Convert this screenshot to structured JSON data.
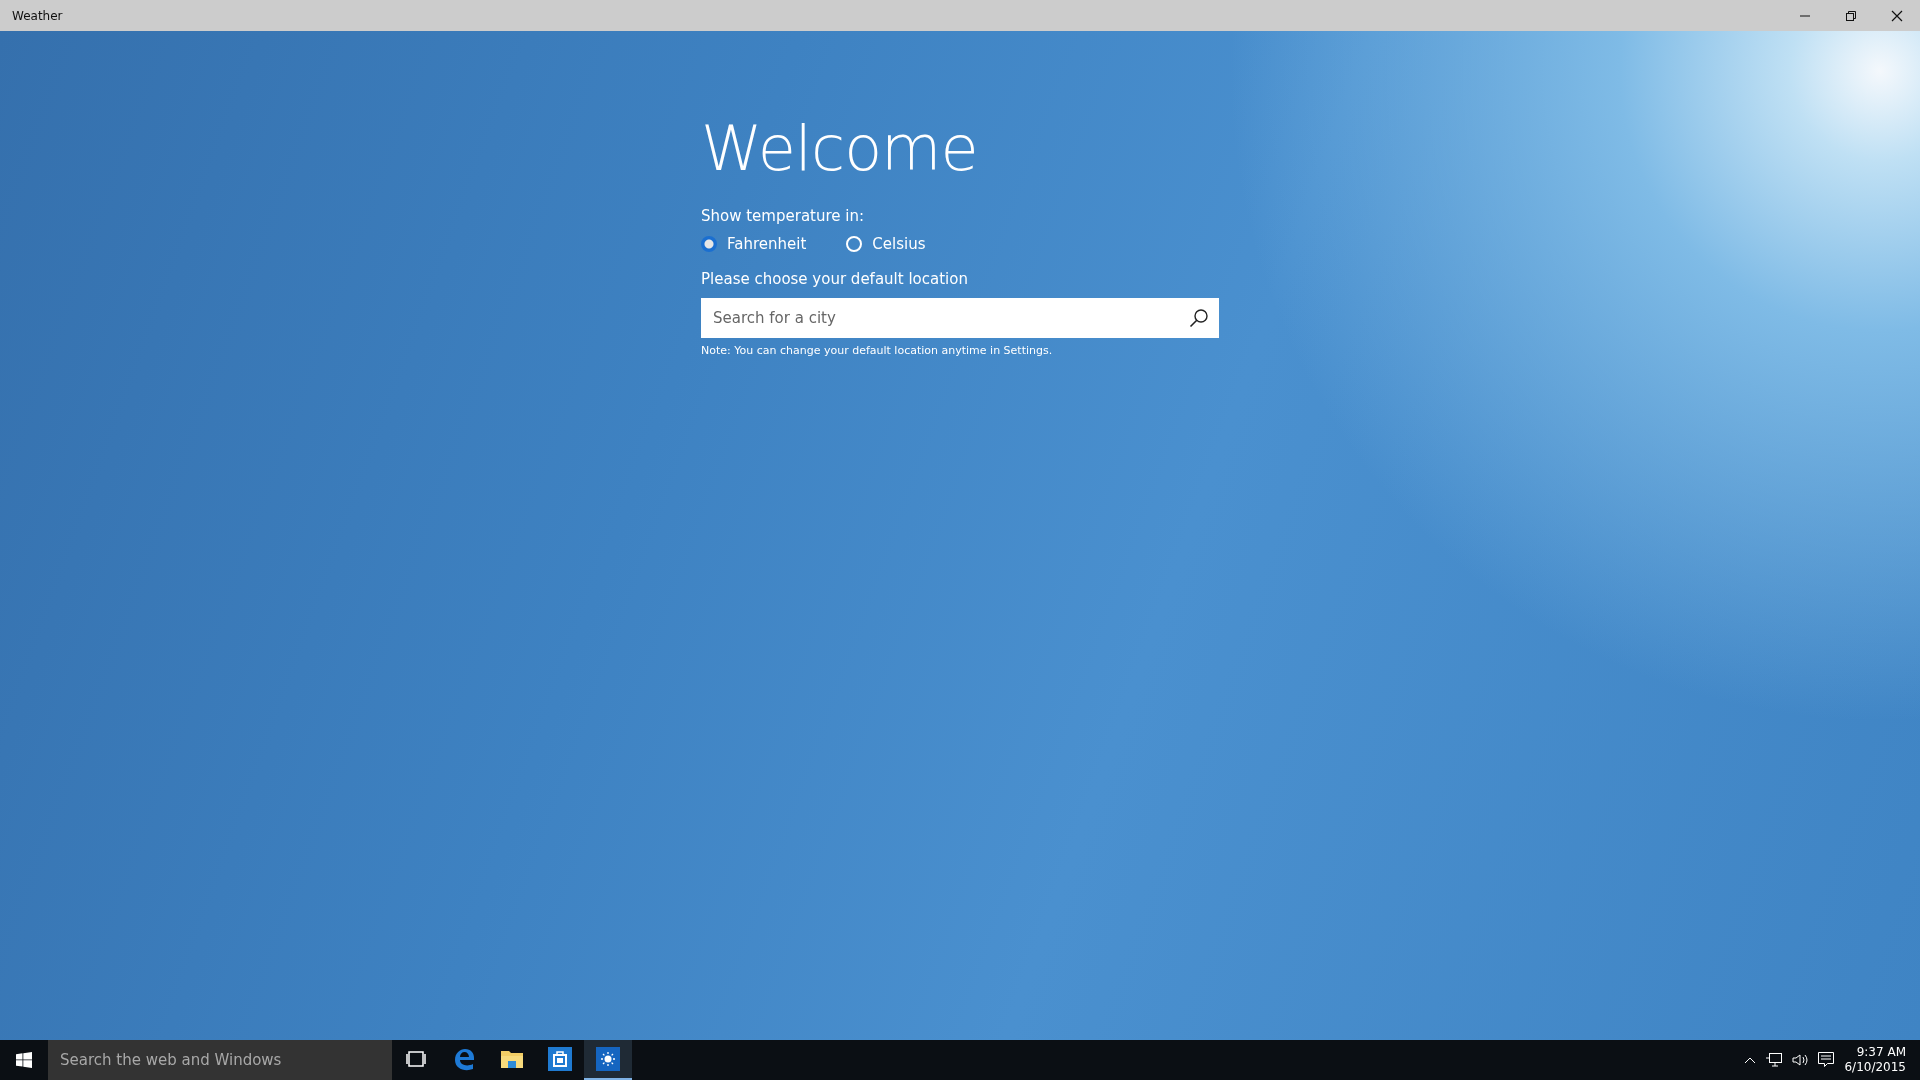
{
  "window": {
    "title": "Weather"
  },
  "welcome": {
    "heading": "Welcome",
    "unit_label": "Show temperature in:",
    "units": [
      {
        "label": "Fahrenheit",
        "selected": true
      },
      {
        "label": "Celsius",
        "selected": false
      }
    ],
    "location_label": "Please choose your default location",
    "search": {
      "placeholder": "Search for a city"
    },
    "note": "Note: You can change your default location anytime in Settings."
  },
  "taskbar": {
    "search": {
      "placeholder": "Search the web and Windows"
    },
    "apps": [
      {
        "kind": "taskview",
        "active": false
      },
      {
        "kind": "edge",
        "active": false
      },
      {
        "kind": "explorer",
        "active": false
      },
      {
        "kind": "store",
        "active": false
      },
      {
        "kind": "weather",
        "active": true
      }
    ],
    "time": "9:37 AM",
    "date": "6/10/2015"
  }
}
